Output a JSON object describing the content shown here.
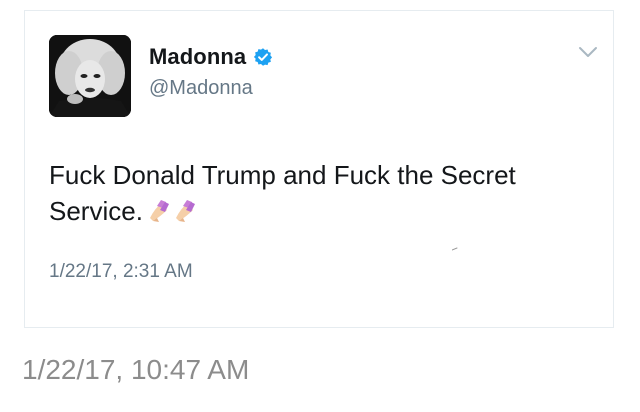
{
  "tweet": {
    "display_name": "Madonna",
    "handle": "@Madonna",
    "text": "Fuck Donald Trump and Fuck the Secret Service.",
    "emoji": "nail-polish-icon",
    "timestamp": "1/22/17, 2:31 AM",
    "verified": true
  },
  "footer": {
    "screenshot_time": "1/22/17, 10:47 AM"
  },
  "colors": {
    "text": "#14171a",
    "secondary": "#657786",
    "verified": "#1da1f2",
    "border": "#e6ecf0",
    "footer_text": "#8c8c8c"
  }
}
